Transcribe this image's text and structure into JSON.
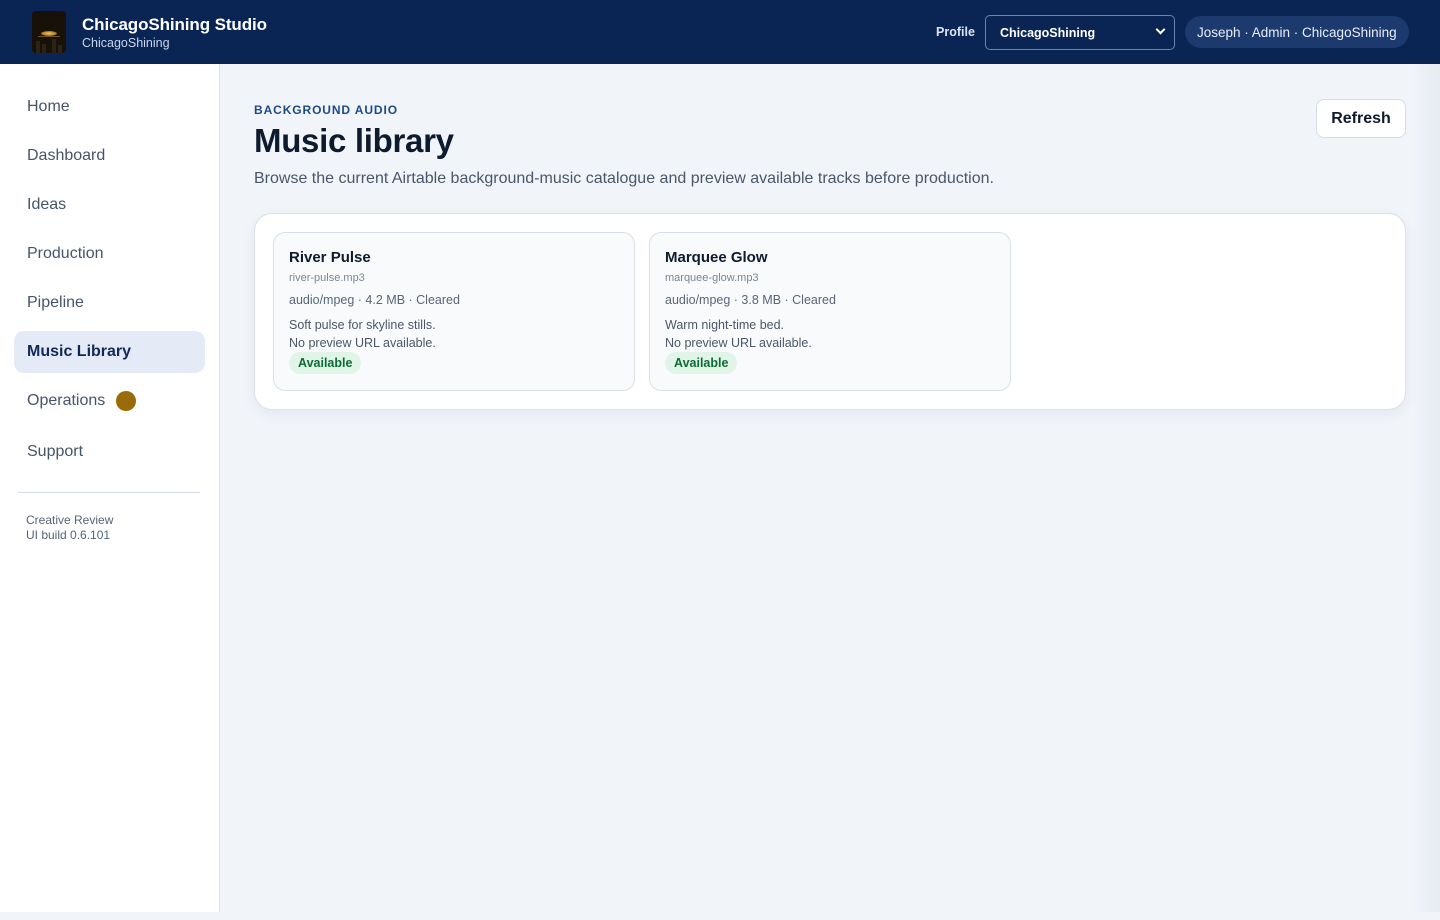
{
  "header": {
    "title": "ChicagoShining Studio",
    "subtitle": "ChicagoShining",
    "profile_label": "Profile",
    "profile_selected": "ChicagoShining",
    "user": "Joseph · Admin · ChicagoShining"
  },
  "sidebar": {
    "items": [
      {
        "label": "Home"
      },
      {
        "label": "Dashboard"
      },
      {
        "label": "Ideas"
      },
      {
        "label": "Production"
      },
      {
        "label": "Pipeline"
      },
      {
        "label": "Music Library",
        "active": true
      },
      {
        "label": "Operations",
        "badge_color": "#9a6b09"
      },
      {
        "label": "Support"
      }
    ],
    "footer": {
      "line1": "Creative Review",
      "line2": "UI build 0.6.101"
    }
  },
  "main": {
    "eyebrow": "BACKGROUND AUDIO",
    "title": "Music library",
    "description": "Browse the current Airtable background-music catalogue and preview available tracks before production.",
    "refresh_label": "Refresh",
    "tracks": [
      {
        "title": "River Pulse",
        "file": "river-pulse.mp3",
        "meta": "audio/mpeg · 4.2 MB · Cleared",
        "description": "Soft pulse for skyline stills.",
        "preview": "No preview URL available.",
        "status": "Available"
      },
      {
        "title": "Marquee Glow",
        "file": "marquee-glow.mp3",
        "meta": "audio/mpeg · 3.8 MB · Cleared",
        "description": "Warm night-time bed.",
        "preview": "No preview URL available.",
        "status": "Available"
      }
    ]
  },
  "colors": {
    "header_bg": "#0a2454",
    "accent": "#1d4a86",
    "active_nav_bg": "#e4ebf7",
    "status_green": "#0f6b36",
    "operations_badge": "#9a6b09"
  }
}
